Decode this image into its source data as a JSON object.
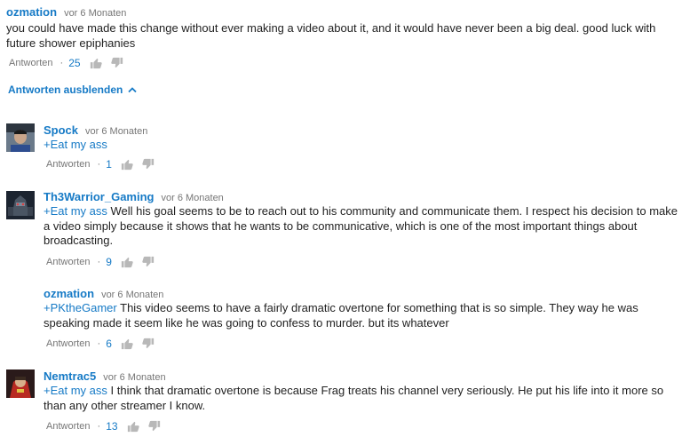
{
  "comments": [
    {
      "author": "ozmation",
      "time": "vor 6 Monaten",
      "mention": "",
      "text": "you could have made this change without ever making a video about it, and it would have never been a big deal. good luck with future shower epiphanies",
      "reply_label": "Antworten",
      "likes": "25"
    }
  ],
  "toggle_label": "Antworten ausblenden",
  "replies": [
    {
      "author": "Spock",
      "time": "vor 6 Monaten",
      "mention": "+Eat my ass",
      "text": "",
      "reply_label": "Antworten",
      "likes": "1",
      "avatar": "avatar-spock"
    },
    {
      "author": "Th3Warrior_Gaming",
      "time": "vor 6 Monaten",
      "mention": "+Eat my ass",
      "text": " Well his goal seems to be to reach out to his community and communicate them. I respect his decision to make a video simply because it shows that he wants to be communicative, which is one of the most important things about broadcasting.",
      "reply_label": "Antworten",
      "likes": "9",
      "avatar": "avatar-robot"
    },
    {
      "author": "ozmation",
      "time": "vor 6 Monaten",
      "mention": "+PKtheGamer",
      "text": " This video seems to have a fairly dramatic overtone for something that is so simple. They way he was speaking made it seem like he was going to confess to murder. but its whatever",
      "reply_label": "Antworten",
      "likes": "6",
      "avatar": ""
    },
    {
      "author": "Nemtrac5",
      "time": "vor 6 Monaten",
      "mention": "+Eat my ass",
      "text": " I think that dramatic overtone is because Frag treats his channel very seriously. He put his life into it more so than any other streamer I know.",
      "reply_label": "Antworten",
      "likes": "13",
      "avatar": "avatar-red"
    }
  ],
  "colors": {
    "link": "#167ac6",
    "meta": "#767676",
    "text": "#222222"
  }
}
